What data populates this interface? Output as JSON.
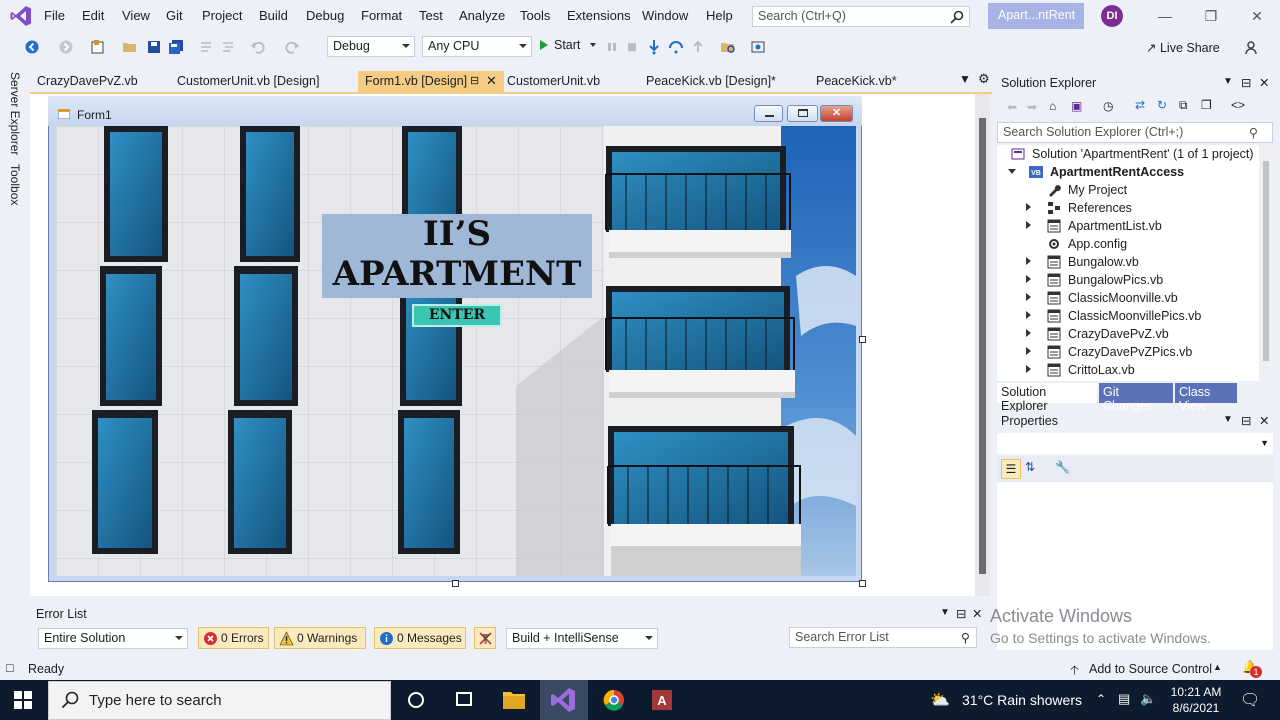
{
  "menu": {
    "items": [
      "File",
      "Edit",
      "View",
      "Git",
      "Project",
      "Build",
      "Debug",
      "Format",
      "Test",
      "Analyze",
      "Tools",
      "Extensions",
      "Window",
      "Help"
    ],
    "search_placeholder": "Search (Ctrl+Q)",
    "solution_name": "Apart...ntRent",
    "avatar_initials": "DI"
  },
  "toolbar": {
    "configuration": "Debug",
    "platform": "Any CPU",
    "start_label": "Start",
    "live_share_label": "Live Share"
  },
  "left_strip": {
    "server_explorer": "Server Explorer",
    "toolbox": "Toolbox"
  },
  "doc_tabs": [
    {
      "label": "CrazyDavePvZ.vb",
      "active": false
    },
    {
      "label": "CustomerUnit.vb [Design]",
      "active": false
    },
    {
      "label": "Form1.vb [Design]",
      "active": true
    },
    {
      "label": "CustomerUnit.vb",
      "active": false
    },
    {
      "label": "PeaceKick.vb [Design]*",
      "active": false
    },
    {
      "label": "PeaceKick.vb*",
      "active": false
    }
  ],
  "form": {
    "title": "Form1",
    "heading_line1": "II’S",
    "heading_line2": "APARTMENT",
    "enter_button": "ENTER"
  },
  "solution_explorer": {
    "title": "Solution Explorer",
    "search_placeholder": "Search Solution Explorer (Ctrl+;)",
    "tree": [
      {
        "label": "Solution 'ApartmentRent' (1 of 1 project)",
        "level": 0,
        "icon": "solution-icon",
        "expander": "none"
      },
      {
        "label": "ApartmentRentAccess",
        "level": 0,
        "icon": "vb-project-icon",
        "expander": "expanded",
        "bold": true
      },
      {
        "label": "My Project",
        "level": 1,
        "icon": "wrench-icon",
        "expander": "none"
      },
      {
        "label": "References",
        "level": 1,
        "icon": "references-icon",
        "expander": "collapsed"
      },
      {
        "label": "ApartmentList.vb",
        "level": 1,
        "icon": "form-file-icon",
        "expander": "collapsed"
      },
      {
        "label": "App.config",
        "level": 1,
        "icon": "config-icon",
        "expander": "none"
      },
      {
        "label": "Bungalow.vb",
        "level": 1,
        "icon": "form-file-icon",
        "expander": "collapsed"
      },
      {
        "label": "BungalowPics.vb",
        "level": 1,
        "icon": "form-file-icon",
        "expander": "collapsed"
      },
      {
        "label": "ClassicMoonville.vb",
        "level": 1,
        "icon": "form-file-icon",
        "expander": "collapsed"
      },
      {
        "label": "ClassicMoonvillePics.vb",
        "level": 1,
        "icon": "form-file-icon",
        "expander": "collapsed"
      },
      {
        "label": "CrazyDavePvZ.vb",
        "level": 1,
        "icon": "form-file-icon",
        "expander": "collapsed"
      },
      {
        "label": "CrazyDavePvZPics.vb",
        "level": 1,
        "icon": "form-file-icon",
        "expander": "collapsed"
      },
      {
        "label": "CrittoLax.vb",
        "level": 1,
        "icon": "form-file-icon",
        "expander": "collapsed"
      }
    ],
    "bottom_tabs": [
      "Solution Explorer",
      "Git Changes",
      "Class View"
    ]
  },
  "properties": {
    "title": "Properties"
  },
  "error_list": {
    "title": "Error List",
    "scope": "Entire Solution",
    "errors": "0 Errors",
    "warnings": "0 Warnings",
    "messages": "0 Messages",
    "build_filter": "Build + IntelliSense",
    "search_placeholder": "Search Error List"
  },
  "watermark": {
    "line1": "Activate Windows",
    "line2": "Go to Settings to activate Windows."
  },
  "status": {
    "ready": "Ready",
    "source_control": "Add to Source Control",
    "notification_count": "1"
  },
  "taskbar": {
    "search_placeholder": "Type here to search",
    "weather": "31°C  Rain showers",
    "time": "10:21 AM",
    "date": "8/6/2021"
  },
  "colors": {
    "accent": "#5c72b8",
    "active_tab": "#f5cc84",
    "enter_button": "#3cc4b2",
    "title_panel": "#9fb8d8"
  }
}
